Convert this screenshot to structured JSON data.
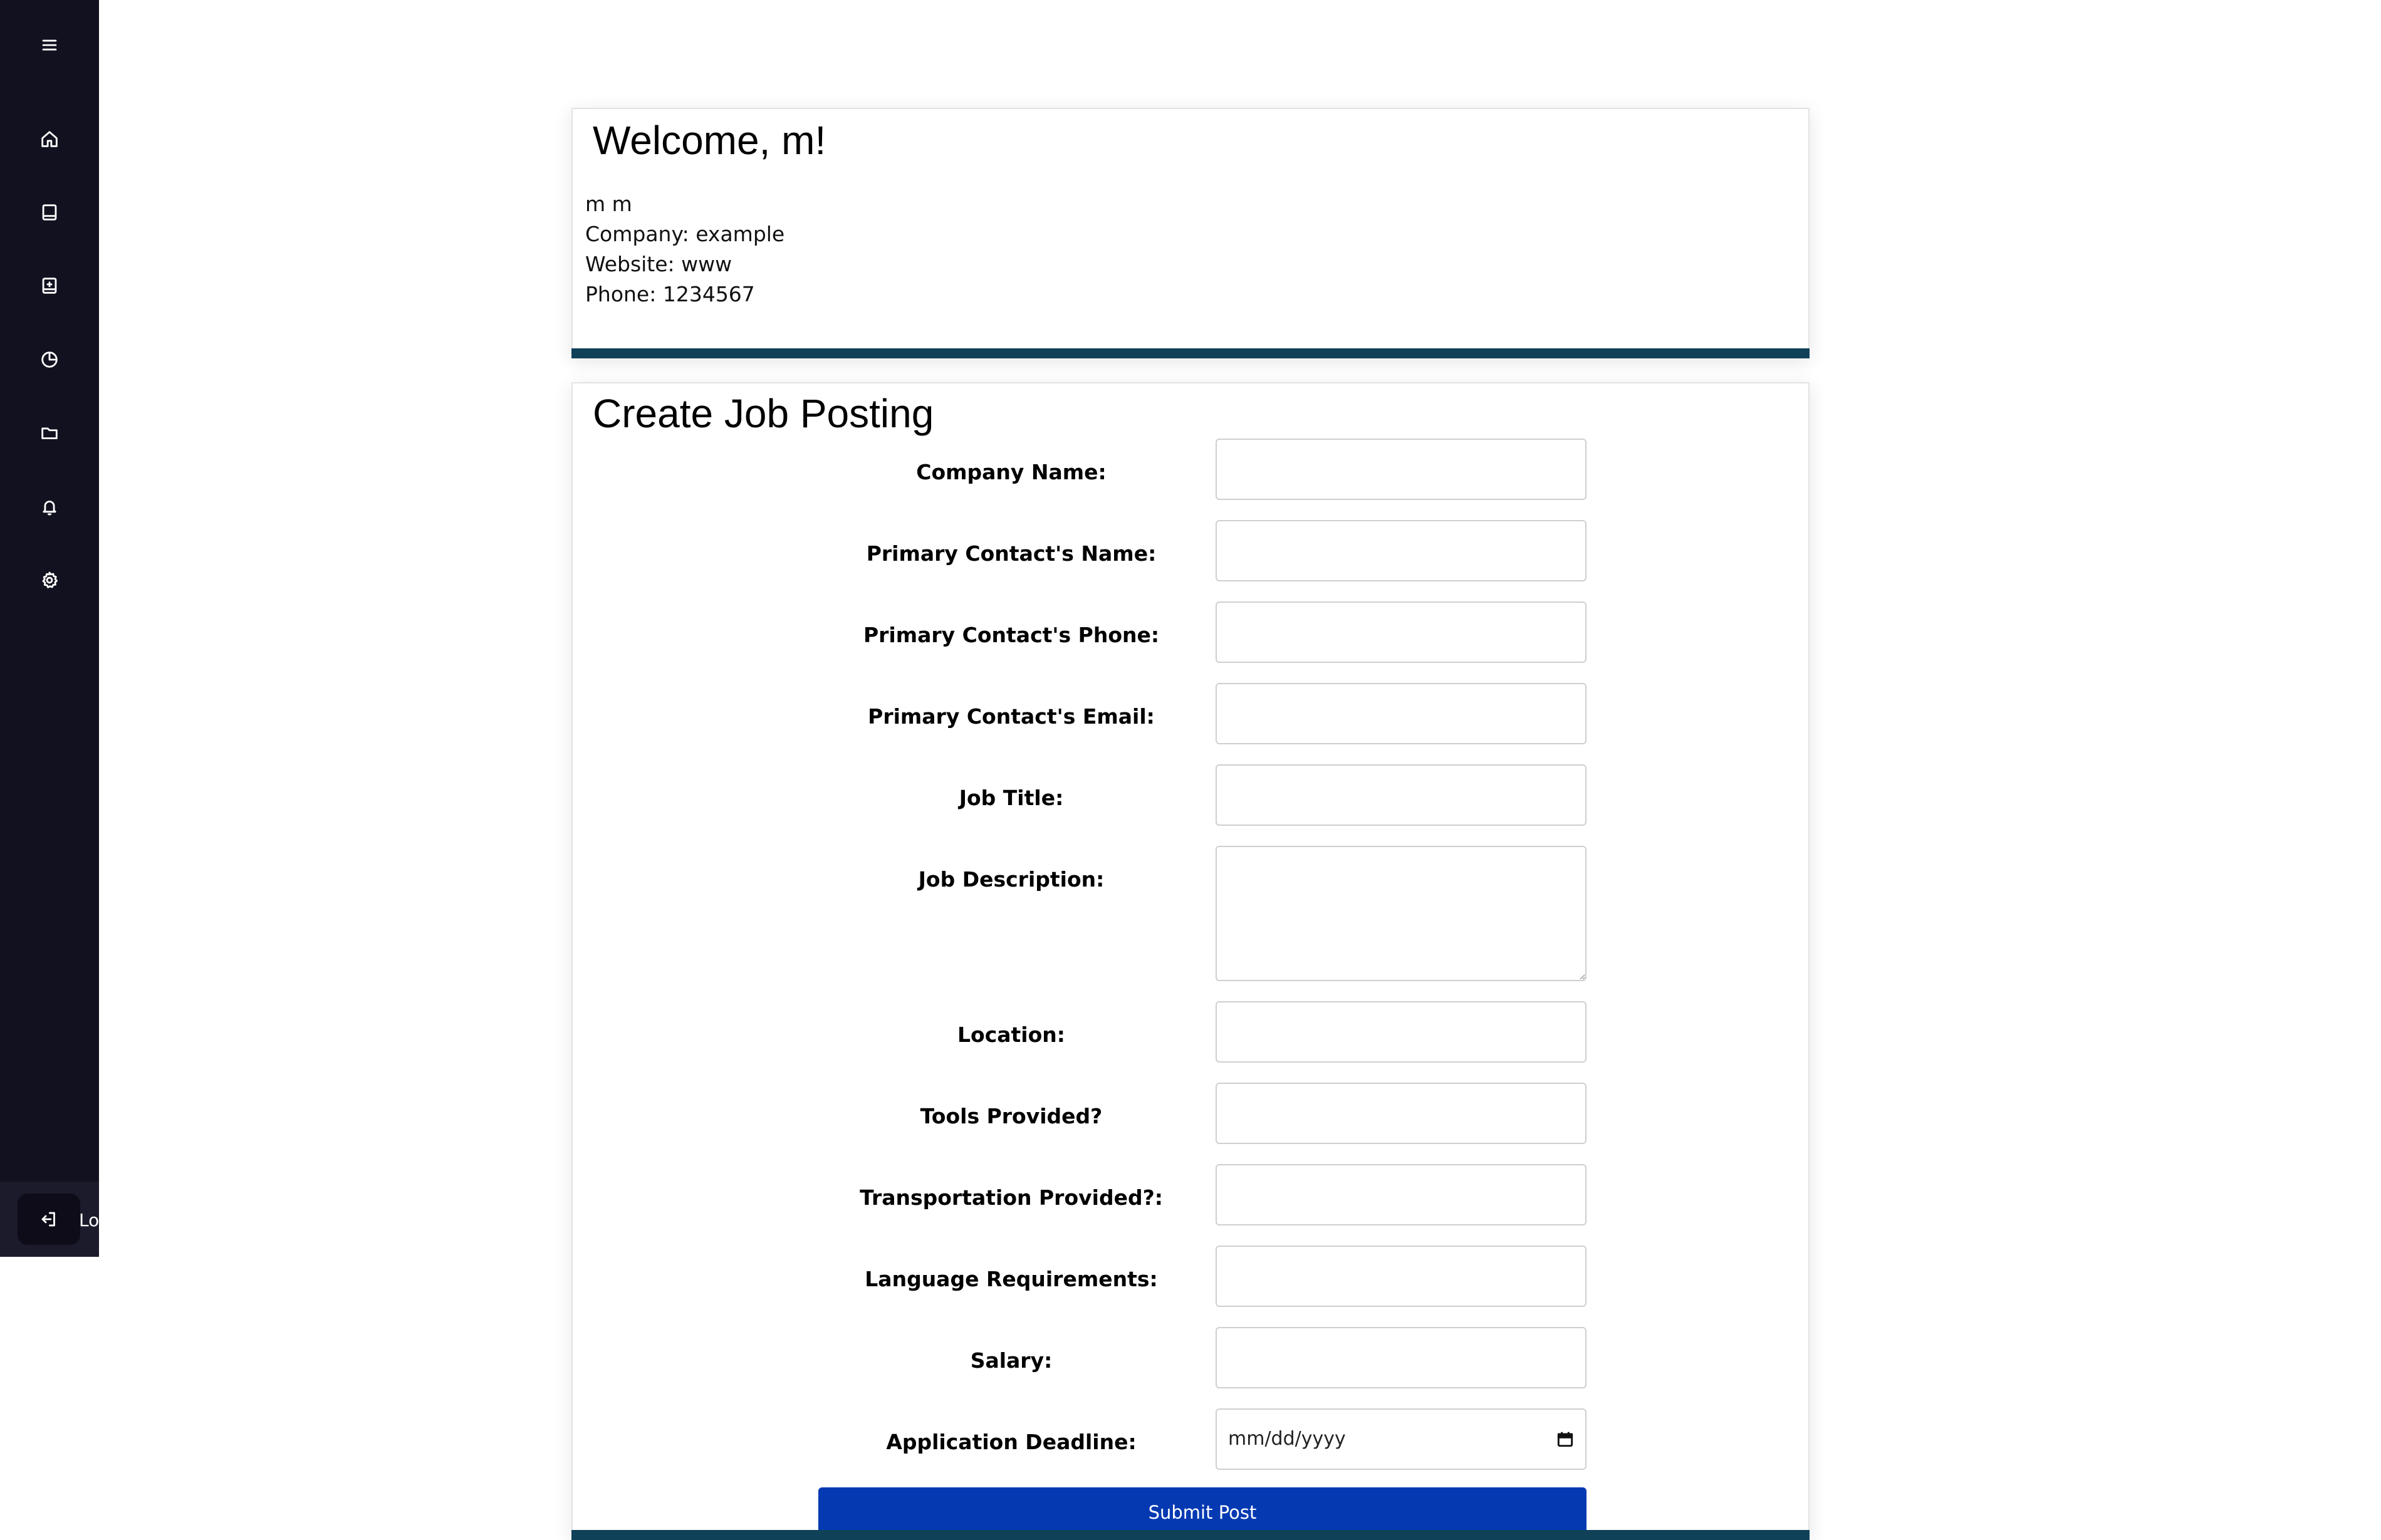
{
  "sidebar": {
    "items": [
      {
        "icon": "menu-icon"
      },
      {
        "icon": "home-icon"
      },
      {
        "icon": "book-icon"
      },
      {
        "icon": "add-post-icon"
      },
      {
        "icon": "chart-icon"
      },
      {
        "icon": "folder-icon"
      },
      {
        "icon": "bell-icon"
      },
      {
        "icon": "gear-icon"
      }
    ],
    "logout": {
      "icon": "logout-icon",
      "label": "Logout"
    }
  },
  "welcome": {
    "title": "Welcome, m!",
    "lines": [
      "m m",
      "Company: example",
      "Website: www",
      "Phone: 1234567"
    ]
  },
  "job_form": {
    "title": "Create Job Posting",
    "fields": [
      {
        "label": "Company Name:",
        "value": ""
      },
      {
        "label": "Primary Contact's Name:",
        "value": ""
      },
      {
        "label": "Primary Contact's Phone:",
        "value": ""
      },
      {
        "label": "Primary Contact's Email:",
        "value": ""
      },
      {
        "label": "Job Title:",
        "value": ""
      },
      {
        "label": "Job Description:",
        "value": ""
      },
      {
        "label": "Location:",
        "value": ""
      },
      {
        "label": "Tools Provided?",
        "value": ""
      },
      {
        "label": "Transportation Provided?:",
        "value": ""
      },
      {
        "label": "Language Requirements:",
        "value": ""
      },
      {
        "label": "Salary:",
        "value": ""
      },
      {
        "label": "Application Deadline:",
        "placeholder": "mm/dd/yyyy"
      }
    ],
    "submit_label": "Submit Post"
  },
  "colors": {
    "sidebar_bg": "#12111f",
    "card_accent": "#0f4158",
    "submit_bg": "#0439b2"
  }
}
